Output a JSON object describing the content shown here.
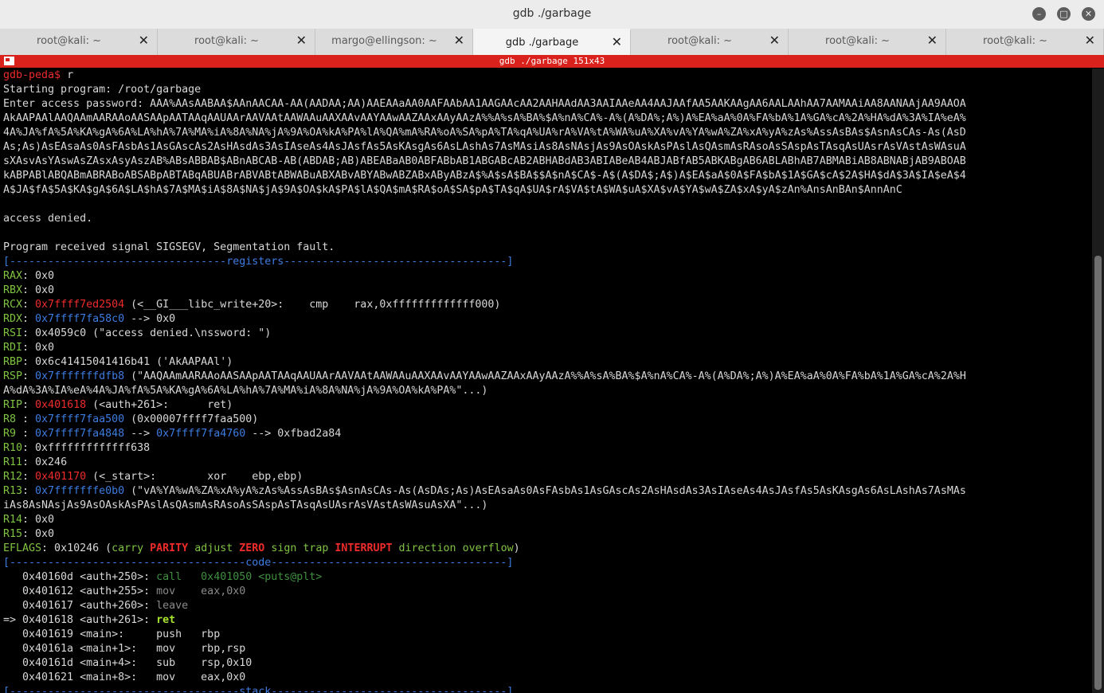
{
  "window": {
    "title": "gdb ./garbage"
  },
  "tabs": [
    {
      "label": "root@kali: ~"
    },
    {
      "label": "root@kali: ~"
    },
    {
      "label": "margo@ellingson: ~"
    },
    {
      "label": "gdb ./garbage"
    },
    {
      "label": "root@kali: ~"
    },
    {
      "label": "root@kali: ~"
    },
    {
      "label": "root@kali: ~"
    }
  ],
  "terminal_header": "gdb ./garbage 151x43",
  "terminal": {
    "prompt": "gdb-peda$",
    "cmd": " r",
    "l_start": "Starting program: /root/garbage",
    "l_pw1": "Enter access password: AAA%AAsAABAA$AAnAACAA-AA(AADAA;AA)AAEAAaAA0AAFAAbAA1AAGAAcAA2AAHAAdAA3AAIAAeAA4AAJAAfAA5AAKAAgAA6AALAAhAA7AAMAAiAA8AANAAjAA9AAOA",
    "l_pw2": "AkAAPAAlAAQAAmAARAAoAASAApAATAAqAAUAArAAVAAtAAWAAuAAXAAvAAYAAwAAZAAxAAyAAzA%%A%sA%BA%$A%nA%CA%-A%(A%DA%;A%)A%EA%aA%0A%FA%bA%1A%GA%cA%2A%HA%dA%3A%IA%eA%",
    "l_pw3": "4A%JA%fA%5A%KA%gA%6A%LA%hA%7A%MA%iA%8A%NA%jA%9A%OA%kA%PA%lA%QA%mA%RA%oA%SA%pA%TA%qA%UA%rA%VA%tA%WA%uA%XA%vA%YA%wA%ZA%xA%yA%zAs%AssAsBAs$AsnAsCAs-As(AsD",
    "l_pw4": "As;As)AsEAsaAs0AsFAsbAs1AsGAscAs2AsHAsdAs3AsIAseAs4AsJAsfAs5AsKAsgAs6AsLAshAs7AsMAsiAs8AsNAsjAs9AsOAskAsPAslAsQAsmAsRAsoAsSAspAsTAsqAsUAsrAsVAstAsWAsuA",
    "l_pw5": "sXAsvAsYAswAsZAsxAsyAszAB%ABsABBAB$ABnABCAB-AB(ABDAB;AB)ABEABaAB0ABFABbAB1ABGABcAB2ABHABdAB3ABIABeAB4ABJABfAB5ABKABgAB6ABLABhAB7ABMABiAB8ABNABjAB9ABOAB",
    "l_pw6": "kABPABlABQABmABRABoABSABpABTABqABUABrABVABtABWABuABXABvABYABwABZABxAByABzA$%A$sA$BA$$A$nA$CA$-A$(A$DA$;A$)A$EA$aA$0A$FA$bA$1A$GA$cA$2A$HA$dA$3A$IA$eA$4",
    "l_pw7": "A$JA$fA$5A$KA$gA$6A$LA$hA$7A$MA$iA$8A$NA$jA$9A$OA$kA$PA$lA$QA$mA$RA$oA$SA$pA$TA$qA$UA$rA$VA$tA$WA$uA$XA$vA$YA$wA$ZA$xA$yA$zAn%AnsAnBAn$AnnAnC",
    "l_denied": "access denied.",
    "l_signal": "Program received signal SIGSEGV, Segmentation fault.",
    "sep_registers": "[----------------------------------registers-----------------------------------]",
    "rax_n": "RAX",
    "rax_v": ": 0x0",
    "rbx_n": "RBX",
    "rbx_v": ": 0x0",
    "rcx_n": "RCX",
    "rcx_sep": ": ",
    "rcx_addr": "0x7ffff7ed2504",
    "rcx_rest": " (<__GI___libc_write+20>:\tcmp    rax,0xfffffffffffff000)",
    "rdx_n": "RDX",
    "rdx_sep": ": ",
    "rdx_addr": "0x7ffff7fa58c0",
    "rdx_rest": " --> 0x0",
    "rsi_n": "RSI",
    "rsi_v": ": 0x4059c0 (\"access denied.\\nssword: \")",
    "rdi_n": "RDI",
    "rdi_v": ": 0x0",
    "rbp_n": "RBP",
    "rbp_v": ": 0x6c41415041416b41 ('AkAAPAAl')",
    "rsp_n": "RSP",
    "rsp_sep": ": ",
    "rsp_addr": "0x7fffffffdfb8",
    "rsp_rest1": " (\"AAQAAmAARAAoAASAApAATAAqAAUAArAAVAAtAAWAAuAAXAAvAAYAAwAAZAAxAAyAAzA%%A%sA%BA%$A%nA%CA%-A%(A%DA%;A%)A%EA%aA%0A%FA%bA%1A%GA%cA%2A%H",
    "rsp_rest2": "A%dA%3A%IA%eA%4A%JA%fA%5A%KA%gA%6A%LA%hA%7A%MA%iA%8A%NA%jA%9A%OA%kA%PA%\"...)",
    "rip_n": "RIP",
    "rip_sep": ": ",
    "rip_addr": "0x401618",
    "rip_rest": " (<auth+261>:\tret)",
    "r8_n": "R8 ",
    "r8_sep": ": ",
    "r8_addr": "0x7ffff7faa500",
    "r8_rest": " (0x00007ffff7faa500)",
    "r9_n": "R9 ",
    "r9_sep": ": ",
    "r9_addr1": "0x7ffff7fa4848",
    "r9_mid": " --> ",
    "r9_addr2": "0x7ffff7fa4760",
    "r9_rest": " --> 0xfbad2a84",
    "r10_n": "R10",
    "r10_v": ": 0xfffffffffffff638",
    "r11_n": "R11",
    "r11_v": ": 0x246",
    "r12_n": "R12",
    "r12_sep": ": ",
    "r12_addr": "0x401170",
    "r12_rest": " (<_start>:\txor    ebp,ebp)",
    "r13_n": "R13",
    "r13_sep": ": ",
    "r13_addr": "0x7fffffffe0b0",
    "r13_rest1": " (\"vA%YA%wA%ZA%xA%yA%zAs%AssAsBAs$AsnAsCAs-As(AsDAs;As)AsEAsaAs0AsFAsbAs1AsGAscAs2AsHAsdAs3AsIAseAs4AsJAsfAs5AsKAsgAs6AsLAshAs7AsMAs",
    "r13_rest2": "iAs8AsNAsjAs9AsOAskAsPAslAsQAsmAsRAsoAsSAspAsTAsqAsUAsrAsVAstAsWAsuAsXA\"...)",
    "r14_n": "R14",
    "r14_v": ": 0x0",
    "r15_n": "R15",
    "r15_v": ": 0x0",
    "ef_n": "EFLAGS",
    "ef_v": ": 0x10246 (",
    "f_carry": "carry",
    "f_parity": "PARITY",
    "f_adjust": "adjust",
    "f_zero": "ZERO",
    "f_sign": "sign",
    "f_trap": "trap",
    "f_interrupt": "INTERRUPT",
    "f_direction": "direction",
    "f_overflow": "overflow",
    "ef_close": ")",
    "sep_code": "[-------------------------------------code-------------------------------------]",
    "c1_a": "   0x40160d <auth+250>:\t",
    "c1_b": "call   0x401050 <puts@plt>",
    "c2_a": "   0x401612 <auth+255>:\t",
    "c2_b": "mov    eax,0x0",
    "c3_a": "   0x401617 <auth+260>:\t",
    "c3_b": "leave",
    "c4_a": "=> 0x401618 <auth+261>:\t",
    "c4_b": "ret",
    "c5": "   0x401619 <main>:\tpush   rbp",
    "c6": "   0x40161a <main+1>:\tmov    rbp,rsp",
    "c7": "   0x40161d <main+4>:\tsub    rsp,0x10",
    "c8": "   0x401621 <main+8>:\tmov    eax,0x0",
    "sep_stack": "[------------------------------------stack-------------------------------------]"
  }
}
